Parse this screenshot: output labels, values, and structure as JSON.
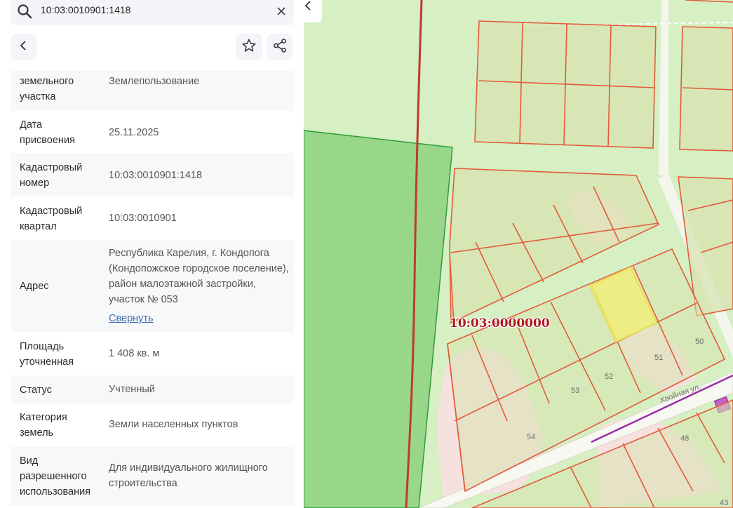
{
  "search": {
    "value": "10:03:0010901:1418",
    "search_icon": "search-icon",
    "clear_icon": "close-icon"
  },
  "toolbar": {
    "back_icon": "chevron-left-icon",
    "favorite_icon": "star-icon",
    "share_icon": "share-icon"
  },
  "properties": [
    {
      "label": "земельного\nучастка",
      "value": "Землепользование"
    },
    {
      "label": "Дата\nприсвоения",
      "value": "25.11.2025"
    },
    {
      "label": "Кадастровый\nномер",
      "value": "10:03:0010901:1418"
    },
    {
      "label": "Кадастровый\nквартал",
      "value": "10:03:0010901"
    },
    {
      "label": "Адрес",
      "value": "Республика Карелия, г. Кондопога (Кондопожское городское поселение), район малоэтажной застройки, участок № 053",
      "link": "Свернуть"
    },
    {
      "label": "Площадь\nуточненная",
      "value": "1 408 кв. м"
    },
    {
      "label": "Статус",
      "value": "Учтенный"
    },
    {
      "label": "Категория\nземель",
      "value": "Земли населенных пунктов"
    },
    {
      "label": "Вид\nразрешенного\nиспользования",
      "value": "Для индивидуального жилищного строительства"
    }
  ],
  "map": {
    "collapse_icon": "chevron-left-icon",
    "quarter_label": "10:03:0000000",
    "street_label": "Хвойная ул.",
    "parcel_numbers": [
      "50",
      "51",
      "52",
      "53",
      "54",
      "48",
      "43"
    ],
    "colors": {
      "background": "#d6efc3",
      "parcel_fill": "#d8e3b0",
      "parcel_border": "#e45a3a",
      "selected_fill": "#f0ef7a",
      "selected_border": "#e8e04a",
      "forest": "#98d68a",
      "boundary_red": "#c0392b",
      "road": "#f7f8f2",
      "building_pink": "#f6e1df",
      "purple": "#9b2fa4"
    }
  }
}
